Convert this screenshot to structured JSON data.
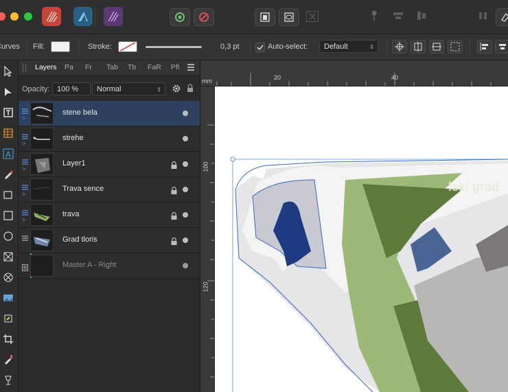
{
  "toolbar": {
    "curves_label": "Curves",
    "fill_label": "Fill:",
    "stroke_label": "Stroke:",
    "stroke_width": "0,3 pt",
    "autoselect_label": "Auto-select:",
    "autoselect_value": "Default",
    "fill_color": "#f2f2f2"
  },
  "panel": {
    "tabs": [
      "Layers",
      "Pa",
      "Fr",
      "Tab",
      "Tb",
      "FaR",
      "Pfl"
    ],
    "opacity_label": "Opacity:",
    "opacity_value": "100 %",
    "blend_mode": "Normal"
  },
  "layers": [
    {
      "name": "stene bela",
      "selected": true,
      "locked": false,
      "thumb": "stone-white"
    },
    {
      "name": "strehe",
      "selected": false,
      "locked": false,
      "thumb": "roof"
    },
    {
      "name": "Layer1",
      "selected": false,
      "locked": true,
      "thumb": "map-grey"
    },
    {
      "name": "Trava sence",
      "selected": false,
      "locked": true,
      "thumb": "grass-shadow"
    },
    {
      "name": "trava",
      "selected": false,
      "locked": true,
      "thumb": "grass"
    },
    {
      "name": "Grad tloris",
      "selected": false,
      "locked": true,
      "thumb": "castle-plan"
    },
    {
      "name": "Master A - Right",
      "selected": false,
      "locked": false,
      "thumb": "master"
    }
  ],
  "ruler": {
    "unit": "mm",
    "h_ticks": [
      "20",
      "40"
    ],
    "v_ticks": [
      "100",
      "120"
    ]
  },
  "canvas": {
    "watermark_text": "lski grad"
  },
  "colors": {
    "accent": "#2f4160",
    "grass_light": "#9cb978",
    "grass_dark": "#5e7a3a",
    "roof_grey": "#b9b7b6"
  }
}
